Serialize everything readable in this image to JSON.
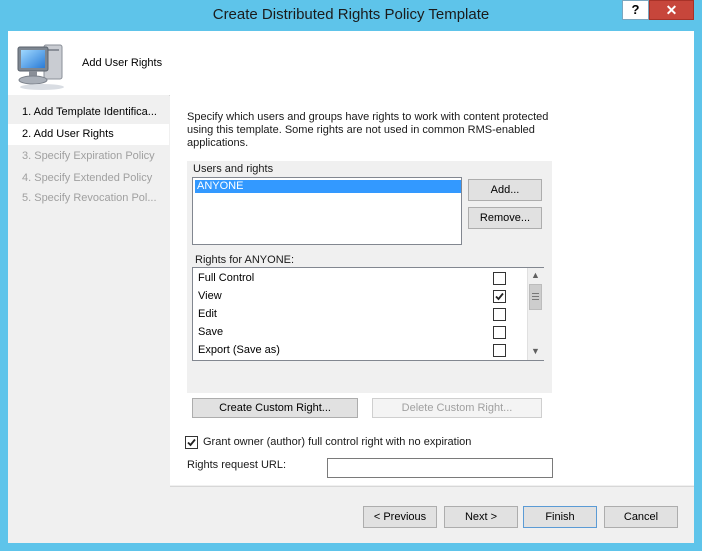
{
  "window": {
    "title": "Create Distributed Rights Policy Template",
    "help_label": "?",
    "close_label": "✕"
  },
  "header": {
    "icon": "computer-icon",
    "label": "Add User Rights"
  },
  "nav": {
    "items": [
      {
        "label": "1. Add Template Identifica...",
        "state": "done"
      },
      {
        "label": "2. Add User Rights",
        "state": "current"
      },
      {
        "label": "3. Specify Expiration Policy",
        "state": "disabled"
      },
      {
        "label": "4. Specify Extended Policy",
        "state": "disabled"
      },
      {
        "label": "5. Specify Revocation Pol...",
        "state": "disabled"
      }
    ]
  },
  "main": {
    "intro": "Specify which users and groups have rights to work with content protected using this template. Some rights are not used in common RMS-enabled applications.",
    "users_label": "Users and rights",
    "users": [
      {
        "name": "ANYONE",
        "selected": true
      }
    ],
    "add_label": "Add...",
    "remove_label": "Remove...",
    "rights_label": "Rights for ANYONE:",
    "rights": [
      {
        "label": "Full Control",
        "checked": false
      },
      {
        "label": "View",
        "checked": true
      },
      {
        "label": "Edit",
        "checked": false
      },
      {
        "label": "Save",
        "checked": false
      },
      {
        "label": "Export (Save as)",
        "checked": false
      }
    ],
    "create_custom_label": "Create Custom Right...",
    "delete_custom_label": "Delete Custom Right...",
    "grant_owner_label": "Grant owner (author) full control right with no expiration",
    "grant_owner_checked": true,
    "rights_url_label": "Rights request URL:",
    "rights_url_value": ""
  },
  "footer": {
    "previous_label": "< Previous",
    "next_label": "Next >",
    "finish_label": "Finish",
    "cancel_label": "Cancel"
  },
  "colors": {
    "frame": "#5ec4ea",
    "selection": "#3399ff",
    "close": "#c7463b"
  }
}
